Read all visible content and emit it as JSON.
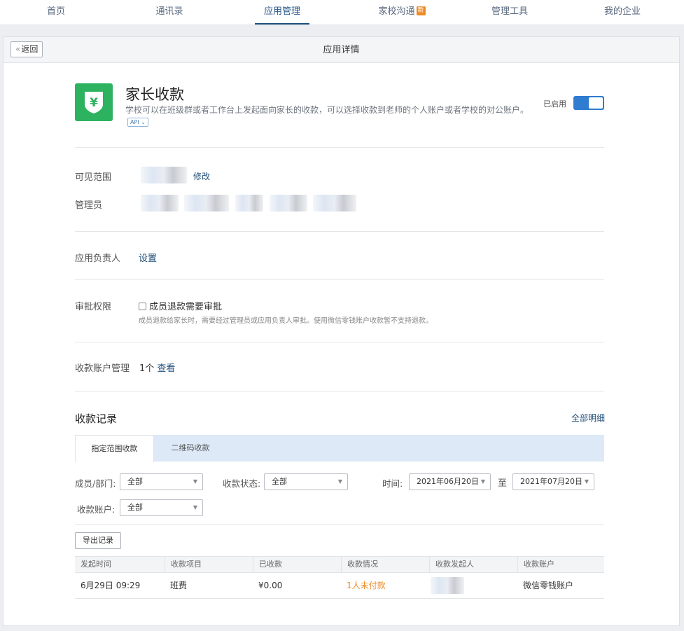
{
  "nav": {
    "items": [
      {
        "label": "首页"
      },
      {
        "label": "通讯录"
      },
      {
        "label": "应用管理"
      },
      {
        "label": "家校沟通",
        "badge": "新"
      },
      {
        "label": "管理工具"
      },
      {
        "label": "我的企业"
      }
    ],
    "active_index": 2
  },
  "header": {
    "back_label": "返回",
    "title": "应用详情"
  },
  "app": {
    "name": "家长收款",
    "description": "学校可以在班级群或者工作台上发起面向家长的收款，可以选择收款到老师的个人账户或者学校的对公账户。",
    "api_tag": "API",
    "status_label": "已启用",
    "enabled": true,
    "icon": "yuan-shield-icon"
  },
  "settings": {
    "visible_scope_label": "可见范围",
    "modify_link": "修改",
    "admin_label": "管理员",
    "owner_label": "应用负责人",
    "owner_set_link": "设置",
    "approval_label": "审批权限",
    "approval_checkbox_label": "成员退款需要审批",
    "approval_checked": false,
    "approval_hint": "成员退款给家长时，需要经过管理员或应用负责人审批。使用微信零钱账户收款暂不支持退款。",
    "account_mgmt_label": "收款账户管理",
    "account_count": "1个",
    "view_link": "查看"
  },
  "records": {
    "title": "收款记录",
    "all_detail_link": "全部明细",
    "tabs": [
      {
        "label": "指定范围收款"
      },
      {
        "label": "二维码收款"
      }
    ],
    "active_tab": 0,
    "filters": {
      "member_label": "成员/部门:",
      "member_value": "全部",
      "status_label": "收款状态:",
      "status_value": "全部",
      "time_label": "时间:",
      "time_from": "2021年06月20日",
      "time_sep": "至",
      "time_to": "2021年07月20日",
      "account_label": "收款账户:",
      "account_value": "全部"
    },
    "export_label": "导出记录",
    "columns": [
      "发起时间",
      "收款项目",
      "已收款",
      "收款情况",
      "收款发起人",
      "收款账户"
    ],
    "rows": [
      {
        "time": "6月29日 09:29",
        "item": "班费",
        "received": "¥0.00",
        "status": "1人未付款",
        "initiator": "",
        "account": "微信零钱账户"
      }
    ]
  },
  "colors": {
    "accent": "#1f4e7a",
    "toggle_on": "#2f7cd0",
    "app_icon_bg": "#2db25f",
    "warning_orange": "#f08a24",
    "tab_bar_bg": "#dde9f7"
  }
}
